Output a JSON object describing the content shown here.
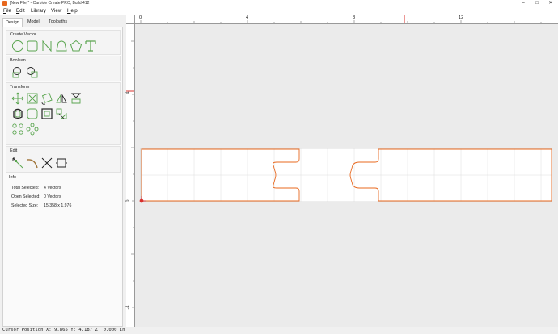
{
  "window": {
    "title": "[New File]* - Carbide Create PRO, Build 412",
    "controls": [
      "–",
      "□",
      "✕"
    ]
  },
  "menu": [
    {
      "label": "File",
      "u": "F",
      "rest": "ile"
    },
    {
      "label": "Edit",
      "u": "E",
      "rest": "dit"
    },
    {
      "label": "Library",
      "u": "",
      "rest": "Library"
    },
    {
      "label": "View",
      "u": "",
      "rest": "View"
    },
    {
      "label": "Help",
      "u": "H",
      "rest": "elp"
    }
  ],
  "tabs": [
    "Design",
    "Model",
    "Toolpaths"
  ],
  "sections": {
    "create_vector": "Create Vector",
    "boolean": "Boolean",
    "transform": "Transform",
    "edit": "Edit",
    "info": "Info"
  },
  "info": {
    "total_selected_label": "Total Selected:",
    "total_selected_value": "4 Vectors",
    "open_selected_label": "Open Selected:",
    "open_selected_value": "0 Vectors",
    "selected_size_label": "Selected Size:",
    "selected_size_value": "15.358 x 1.976"
  },
  "ruler": {
    "top_labels": [
      "0",
      "4",
      "8",
      "12"
    ],
    "left_labels": [
      "4",
      "0",
      "-4"
    ]
  },
  "colors": {
    "icon_green": "#5aa54f",
    "vector_orange": "#e8681e",
    "selection_red": "#d9302c"
  },
  "status": "Cursor Position X: 9.865 Y: 4.187 Z: 0.000 in"
}
